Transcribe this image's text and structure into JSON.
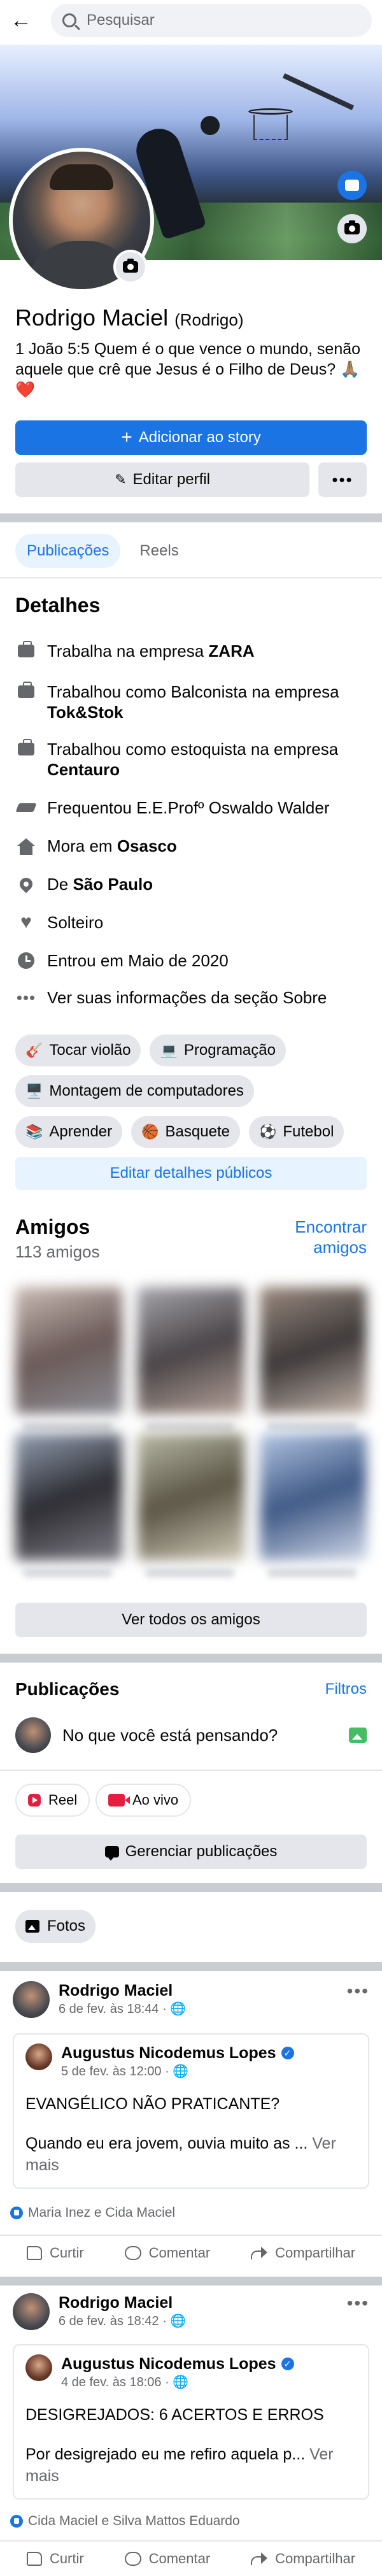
{
  "search": {
    "placeholder": "Pesquisar"
  },
  "profile": {
    "name": "Rodrigo Maciel",
    "nickname": "(Rodrigo)",
    "bio": "1 João 5:5 Quem é o que vence o mundo, senão aquele que crê que Jesus é o Filho de Deus? 🙏🏽❤️"
  },
  "actions": {
    "add_story": "Adicionar ao story",
    "edit_profile": "Editar perfil",
    "more": "•••"
  },
  "tabs": [
    "Publicações",
    "Reels"
  ],
  "details": {
    "title": "Detalhes",
    "work1_prefix": "Trabalha na empresa ",
    "work1_company": "ZARA",
    "work2_prefix": "Trabalhou como Balconista na empresa ",
    "work2_company": "Tok&Stok",
    "work3_prefix": "Trabalhou como estoquista na empresa ",
    "work3_company": "Centauro",
    "education": "Frequentou E.E.Profº Oswaldo Walder",
    "lives_prefix": "Mora em ",
    "lives_city": "Osasco",
    "from_prefix": "De ",
    "from_city": "São Paulo",
    "relationship": "Solteiro",
    "joined": "Entrou em Maio de 2020",
    "see_about": "Ver suas informações da seção Sobre"
  },
  "hobbies": [
    {
      "emoji": "🎸",
      "label": "Tocar violão"
    },
    {
      "emoji": "💻",
      "label": "Programação"
    },
    {
      "emoji": "🖥️",
      "label": "Montagem de computadores"
    },
    {
      "emoji": "📚",
      "label": "Aprender"
    },
    {
      "emoji": "🏀",
      "label": "Basquete"
    },
    {
      "emoji": "⚽",
      "label": "Futebol"
    }
  ],
  "edit_public_details": "Editar detalhes públicos",
  "friends": {
    "title": "Amigos",
    "count": "113 amigos",
    "find": "Encontrar amigos",
    "see_all": "Ver todos os amigos"
  },
  "publications": {
    "title": "Publicações",
    "filters": "Filtros",
    "composer_placeholder": "No que você está pensando?",
    "reel": "Reel",
    "live": "Ao vivo",
    "manage": "Gerenciar publicações",
    "photos": "Fotos"
  },
  "posts": [
    {
      "author": "Rodrigo Maciel",
      "time": "6 de fev. às 18:44 · 🌐",
      "shared_author": "Augustus Nicodemus Lopes",
      "shared_time": "5 de fev. às 12:00 · 🌐",
      "shared_title": "EVANGÉLICO NÃO PRATICANTE?",
      "shared_body": "Quando eu era jovem, ouvia muito as ... ",
      "see_more": "Ver mais",
      "reactions": "Maria Inez e Cida Maciel"
    },
    {
      "author": "Rodrigo Maciel",
      "time": "6 de fev. às 18:42 · 🌐",
      "shared_author": "Augustus Nicodemus Lopes",
      "shared_time": "4 de fev. às 18:06 · 🌐",
      "shared_title": "DESIGREJADOS: 6 ACERTOS E ERROS",
      "shared_body": "Por desigrejado eu me refiro aquela p... ",
      "see_more": "Ver mais",
      "reactions": "Cida Maciel e Silva Mattos Eduardo"
    }
  ],
  "post_actions": {
    "like": "Curtir",
    "comment": "Comentar",
    "share": "Compartilhar"
  },
  "colors": {
    "accent": "#1b74e4",
    "separator": "#c9ccd1",
    "muted": "#65676b"
  }
}
